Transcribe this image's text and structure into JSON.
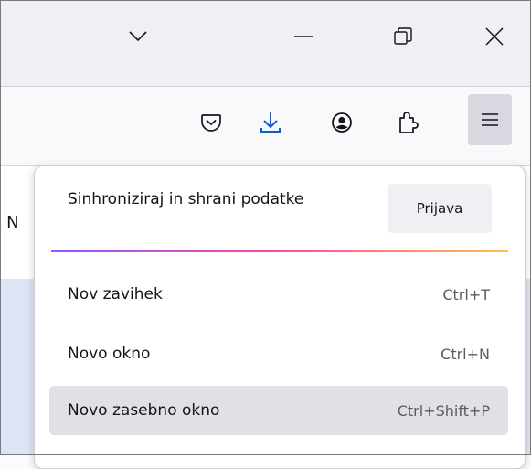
{
  "window": {
    "controls": [
      "list-all-tabs",
      "minimize",
      "restore",
      "close"
    ]
  },
  "toolbar": {
    "icons": [
      "pocket-icon",
      "download-icon",
      "account-icon",
      "extensions-icon",
      "hamburger-menu-icon"
    ],
    "accent": "#0060df"
  },
  "page": {
    "partial_text": "s N"
  },
  "menu": {
    "sync_text": "Sinhroniziraj in shrani podatke",
    "signin_label": "Prijava",
    "items": [
      {
        "label": "Nov zavihek",
        "shortcut": "Ctrl+T"
      },
      {
        "label": "Novo okno",
        "shortcut": "Ctrl+N"
      },
      {
        "label": "Novo zasebno okno",
        "shortcut": "Ctrl+Shift+P"
      }
    ]
  }
}
